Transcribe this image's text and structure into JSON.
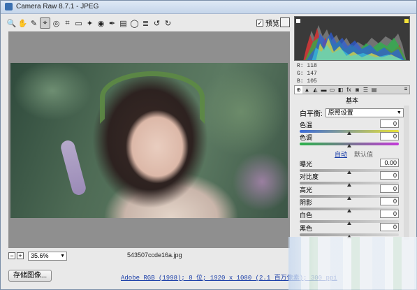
{
  "window": {
    "title": "Camera Raw 8.7.1 -  JPEG"
  },
  "toolbar": {
    "tools": [
      {
        "name": "zoom-tool-icon",
        "glyph": "🔍"
      },
      {
        "name": "hand-tool-icon",
        "glyph": "✋"
      },
      {
        "name": "white-balance-tool-icon",
        "glyph": "✎"
      },
      {
        "name": "color-sampler-tool-icon",
        "glyph": "⌖",
        "active": true
      },
      {
        "name": "targeted-adjustment-tool-icon",
        "glyph": "◎"
      },
      {
        "name": "crop-tool-icon",
        "glyph": "⌗"
      },
      {
        "name": "straighten-tool-icon",
        "glyph": "▭"
      },
      {
        "name": "spot-removal-tool-icon",
        "glyph": "✦"
      },
      {
        "name": "red-eye-tool-icon",
        "glyph": "◉"
      },
      {
        "name": "adjustment-brush-icon",
        "glyph": "✒"
      },
      {
        "name": "graduated-filter-icon",
        "glyph": "▤"
      },
      {
        "name": "radial-filter-icon",
        "glyph": "◯"
      },
      {
        "name": "preferences-icon",
        "glyph": "≣"
      },
      {
        "name": "rotate-left-icon",
        "glyph": "↺"
      },
      {
        "name": "rotate-right-icon",
        "glyph": "↻"
      }
    ],
    "preview_label": "预览",
    "preview_checked": "✓"
  },
  "canvas": {
    "zoom_minus": "−",
    "zoom_plus": "+",
    "zoom_level": "35.6%",
    "filename": "543507ccde16a.jpg"
  },
  "footer": {
    "save_label": "存储图像...",
    "workflow_info": "Adobe RGB (1998); 8 位; 1920 x 1080 (2.1 百万像素); 300 ppi"
  },
  "readout": {
    "r": "R:  118",
    "g": "G:  147",
    "b": "B:  105"
  },
  "panel": {
    "tabs": [
      "⊕",
      "▲",
      "◭",
      "▬",
      "▭",
      "◧",
      "fx",
      "◙",
      "☰",
      "▤"
    ],
    "title": "基本",
    "wb_label": "白平衡:",
    "wb_value": "原照设置",
    "auto_label": "自动",
    "default_label": "默认值",
    "sliders": [
      {
        "label": "色温",
        "value": "0",
        "pos": 0.5,
        "track": "temp"
      },
      {
        "label": "色调",
        "value": "0",
        "pos": 0.5,
        "track": "tint"
      },
      {
        "label": "曝光",
        "value": "0.00",
        "pos": 0.5,
        "track": "plain"
      },
      {
        "label": "对比度",
        "value": "0",
        "pos": 0.5,
        "track": "plain"
      },
      {
        "label": "高光",
        "value": "0",
        "pos": 0.5,
        "track": "plain"
      },
      {
        "label": "阴影",
        "value": "0",
        "pos": 0.5,
        "track": "plain"
      },
      {
        "label": "白色",
        "value": "0",
        "pos": 0.5,
        "track": "plain"
      },
      {
        "label": "黑色",
        "value": "0",
        "pos": 0.5,
        "track": "plain"
      }
    ]
  },
  "colors": {
    "link": "#1a3ea8",
    "histogram_bg": "#3a3a3a"
  }
}
